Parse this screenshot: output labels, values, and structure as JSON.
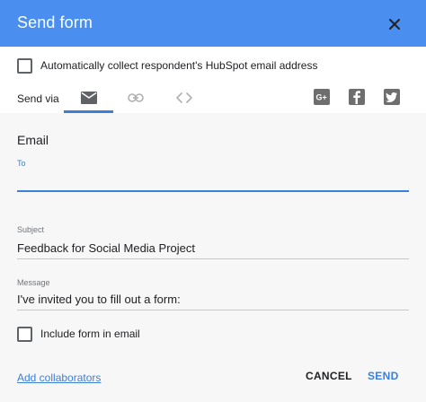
{
  "header": {
    "title": "Send form"
  },
  "collect": {
    "label": "Automatically collect respondent's HubSpot email address"
  },
  "sendvia": {
    "label": "Send via",
    "tabs": [
      {
        "icon": "email-icon"
      },
      {
        "icon": "link-icon"
      },
      {
        "icon": "embed-icon"
      }
    ],
    "social": [
      {
        "icon": "google-plus-icon"
      },
      {
        "icon": "facebook-icon"
      },
      {
        "icon": "twitter-icon"
      }
    ]
  },
  "email": {
    "title": "Email",
    "to_label": "To",
    "to_value": "",
    "subject_label": "Subject",
    "subject_value": "Feedback for Social Media Project",
    "message_label": "Message",
    "message_value": "I've invited you to fill out a form:",
    "include_label": "Include form in email"
  },
  "footer": {
    "add_collaborators": "Add collaborators",
    "cancel": "CANCEL",
    "send": "SEND"
  },
  "colors": {
    "header": "#4a8eef",
    "accent": "#3b7fd8"
  }
}
